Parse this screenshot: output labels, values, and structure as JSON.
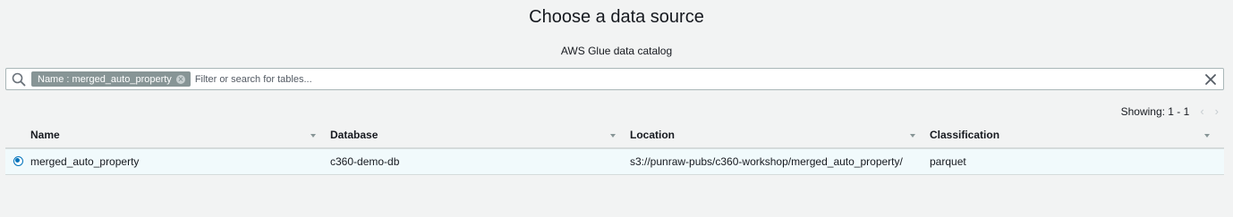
{
  "header": {
    "title": "Choose a data source",
    "subtitle": "AWS Glue data catalog"
  },
  "search": {
    "token_label": "Name : merged_auto_property",
    "placeholder": "Filter or search for tables...",
    "value": ""
  },
  "icons": {
    "search": "search-icon",
    "clear": "close-icon",
    "token_remove": "remove-token-icon",
    "prev": "chevron-left-icon",
    "next": "chevron-right-icon",
    "sort": "caret-down-icon"
  },
  "pagination": {
    "showing": "Showing: 1 - 1"
  },
  "table": {
    "columns": [
      "Name",
      "Database",
      "Location",
      "Classification"
    ],
    "rows": [
      {
        "selected": true,
        "name": "merged_auto_property",
        "database": "c360-demo-db",
        "location": "s3://punraw-pubs/c360-workshop/merged_auto_property/",
        "classification": "parquet"
      }
    ]
  },
  "colors": {
    "background": "#f2f3f3",
    "token": "#879596",
    "selected_row": "#f1fafc",
    "accent": "#0073bb"
  }
}
